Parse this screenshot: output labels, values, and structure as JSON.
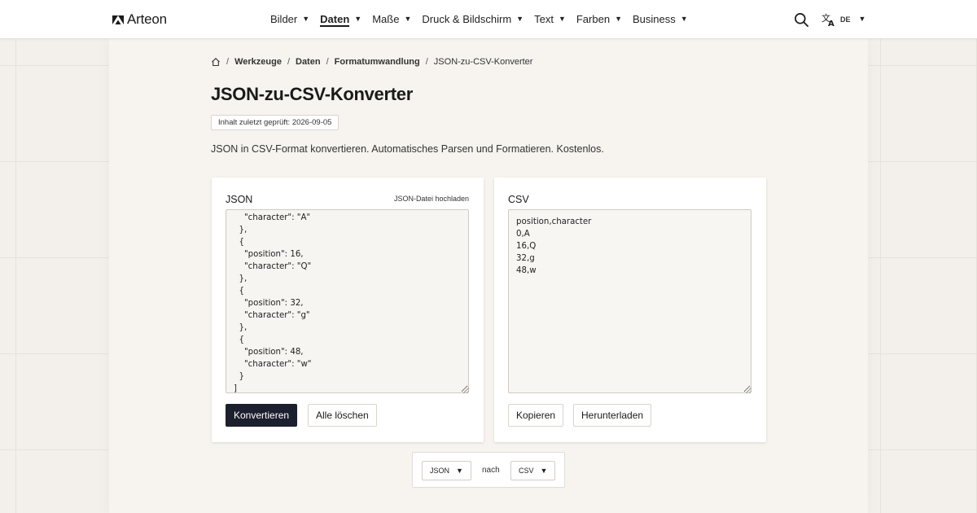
{
  "header": {
    "logo_text": "Arteon",
    "nav": [
      {
        "label": "Bilder",
        "active": false
      },
      {
        "label": "Daten",
        "active": true
      },
      {
        "label": "Maße",
        "active": false
      },
      {
        "label": "Druck & Bildschirm",
        "active": false
      },
      {
        "label": "Text",
        "active": false
      },
      {
        "label": "Farben",
        "active": false
      },
      {
        "label": "Business",
        "active": false
      }
    ],
    "language_code": "DE"
  },
  "breadcrumb": {
    "items": [
      "Werkzeuge",
      "Daten",
      "Formatumwandlung"
    ],
    "current": "JSON-zu-CSV-Konverter"
  },
  "page": {
    "title": "JSON-zu-CSV-Konverter",
    "checked_badge": "Inhalt zuletzt geprüft: 2026-09-05",
    "intro": "JSON in CSV-Format konvertieren. Automatisches Parsen und Formatieren. Kostenlos."
  },
  "input_panel": {
    "title": "JSON",
    "upload_link": "JSON-Datei hochladen",
    "content": "    \"character\": \"A\"\n  },\n  {\n    \"position\": 16,\n    \"character\": \"Q\"\n  },\n  {\n    \"position\": 32,\n    \"character\": \"g\"\n  },\n  {\n    \"position\": 48,\n    \"character\": \"w\"\n  }\n]",
    "convert_label": "Konvertieren",
    "clear_label": "Alle löschen"
  },
  "output_panel": {
    "title": "CSV",
    "content": "position,character\n0,A\n16,Q\n32,g\n48,w",
    "copy_label": "Kopieren",
    "download_label": "Herunterladen"
  },
  "format_selector": {
    "from": "JSON",
    "separator": "nach",
    "to": "CSV"
  },
  "colors": {
    "background": "#f3f0ec",
    "primary_button": "#1c1f2e"
  }
}
